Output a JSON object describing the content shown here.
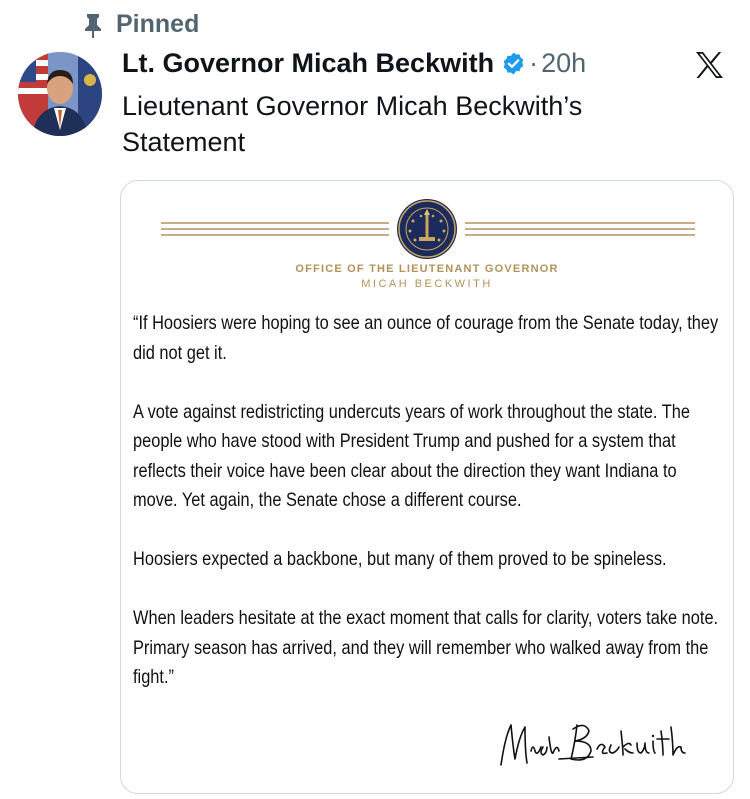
{
  "pinned": {
    "label": "Pinned"
  },
  "author": {
    "display_name": "Lt. Governor Micah Beckwith",
    "timestamp": "20h",
    "separator": "·"
  },
  "tweet": {
    "text": "Lieutenant Governor Micah Beckwith’s Statement"
  },
  "statement_image": {
    "office_title": "OFFICE OF THE LIEUTENANT GOVERNOR",
    "office_name": "MICAH BECKWITH",
    "paragraphs": [
      "“If Hoosiers were hoping to see an ounce of courage from the Senate today, they did not get it.",
      "A vote against redistricting undercuts years of work throughout the state. The people who have stood with President Trump and pushed for a system that reflects their voice have been clear about the direction they want Indiana to move. Yet again, the Senate chose a different course.",
      "Hoosiers expected a backbone, but many of them proved to be spineless.",
      "When leaders hesitate at the exact moment that calls for clarity, voters take note. Primary season has arrived, and they will remember who walked away from the fight.”"
    ]
  },
  "colors": {
    "verified": "#1d9bf0",
    "gold": "#b3925a",
    "seal_blue": "#1d2b5c",
    "muted": "#536471"
  },
  "icons": [
    "pin-icon",
    "verified-icon",
    "x-logo-icon",
    "seal-icon",
    "signature"
  ]
}
